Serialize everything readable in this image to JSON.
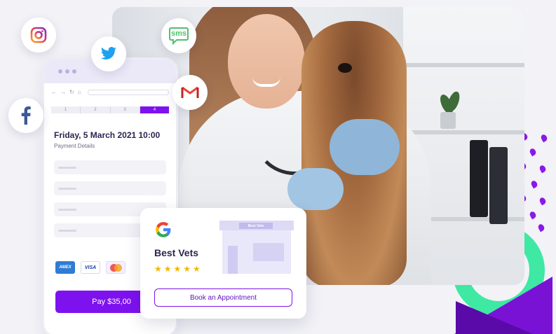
{
  "colors": {
    "accent": "#7d12ef",
    "star": "#f2b705",
    "sms_green": "#4fc06d",
    "ring_green": "#3fe8a3"
  },
  "social": {
    "icons": [
      "instagram-icon",
      "twitter-icon",
      "facebook-icon",
      "sms-icon",
      "gmail-icon"
    ],
    "sms_label": "sms"
  },
  "phone": {
    "steps": [
      "1",
      "2",
      "3",
      "4"
    ],
    "active_step": 4,
    "booking_date": "Friday, 5 March 2021 10:00",
    "booking_subtitle": "Payment Details",
    "cards": [
      "AMEX",
      "VISA",
      "mastercard-icon"
    ],
    "pay_label": "Pay $35,00"
  },
  "google_card": {
    "business_name": "Best Vets",
    "stars": "★★★★★",
    "rating": 5,
    "shop_sign": "Best Vets",
    "book_label": "Book an Appointment"
  }
}
